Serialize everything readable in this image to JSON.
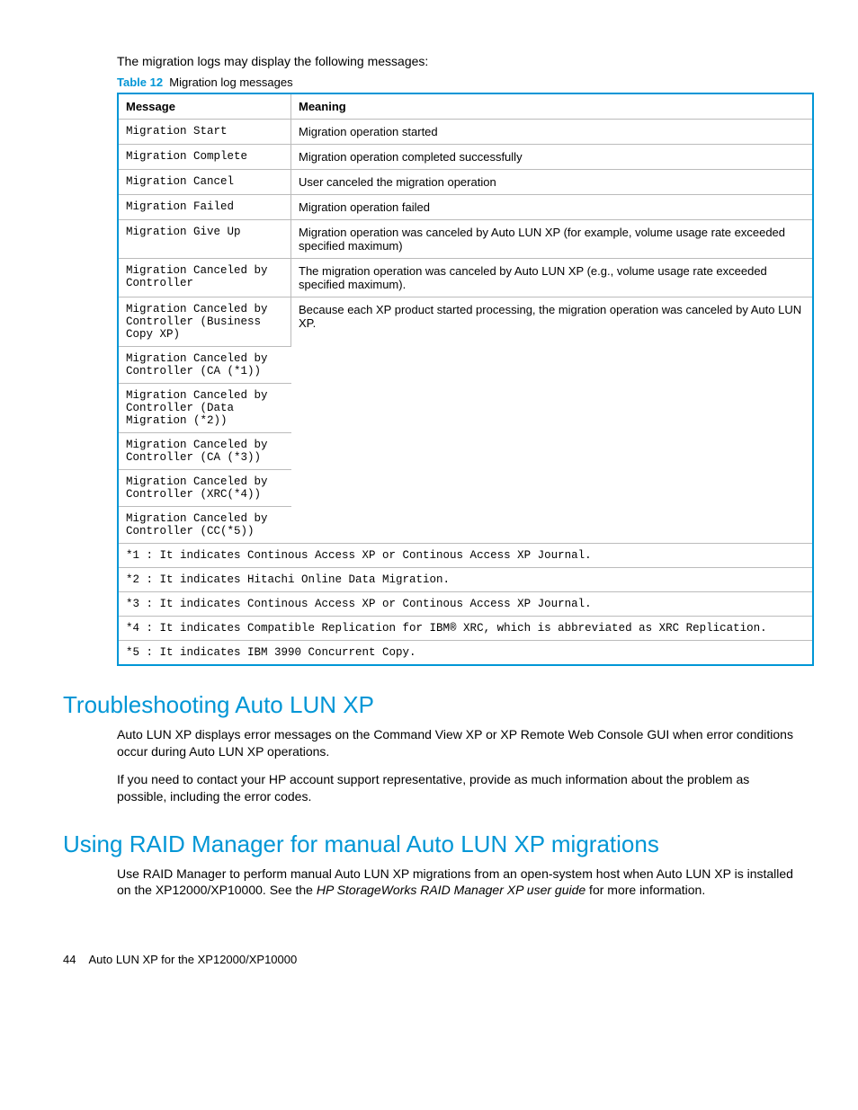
{
  "intro": "The migration logs may display the following messages:",
  "table": {
    "captionLabel": "Table 12",
    "captionText": "Migration log messages",
    "headers": {
      "message": "Message",
      "meaning": "Meaning"
    },
    "rows": [
      {
        "msg": "Migration Start",
        "meaning": "Migration operation started"
      },
      {
        "msg": "Migration Complete",
        "meaning": "Migration operation completed successfully"
      },
      {
        "msg": "Migration Cancel",
        "meaning": "User canceled the migration operation"
      },
      {
        "msg": "Migration Failed",
        "meaning": "Migration operation failed"
      },
      {
        "msg": "Migration Give Up",
        "meaning": "Migration operation was canceled by Auto LUN XP (for example, volume usage rate exceeded specified maximum)"
      },
      {
        "msg": "Migration Canceled by Controller",
        "meaning": "The migration operation was canceled by Auto LUN XP (e.g., volume usage rate exceeded specified maximum)."
      },
      {
        "msg": "Migration Canceled by Controller (Business Copy XP)",
        "meaning": "Because each XP product started processing, the migration operation was canceled by Auto LUN XP."
      },
      {
        "msg": "Migration Canceled by Controller (CA (*1))",
        "meaning": ""
      },
      {
        "msg": "Migration Canceled by Controller (Data Migration (*2))",
        "meaning": ""
      },
      {
        "msg": "Migration Canceled by Controller (CA (*3))",
        "meaning": ""
      },
      {
        "msg": "Migration Canceled by Controller (XRC(*4))",
        "meaning": ""
      },
      {
        "msg": "Migration Canceled by Controller (CC(*5))",
        "meaning": ""
      }
    ],
    "footnotes": [
      "*1 : It indicates Continous Access XP or Continous Access XP Journal.",
      "*2 : It indicates Hitachi Online Data Migration.",
      "*3 : It indicates Continous Access XP or Continous Access XP Journal.",
      "*4 : It indicates Compatible Replication for IBM® XRC, which is abbreviated as XRC Replication.",
      "*5 : It indicates IBM 3990 Concurrent Copy."
    ]
  },
  "sections": {
    "trouble": {
      "heading": "Troubleshooting Auto LUN XP",
      "p1": "Auto LUN XP displays error messages on the Command View XP or XP Remote Web Console GUI when error conditions occur during Auto LUN XP operations.",
      "p2": "If you need to contact your HP account support representative, provide as much information about the problem as possible, including the error codes."
    },
    "raid": {
      "heading": "Using RAID Manager for manual Auto LUN XP migrations",
      "p1a": "Use RAID Manager to perform manual Auto LUN XP migrations from an open-system host when Auto LUN XP is installed on the XP12000/XP10000. See the ",
      "p1ital": "HP StorageWorks RAID Manager XP user guide",
      "p1b": " for more information."
    }
  },
  "footer": {
    "page": "44",
    "title": "Auto LUN XP for the XP12000/XP10000"
  }
}
